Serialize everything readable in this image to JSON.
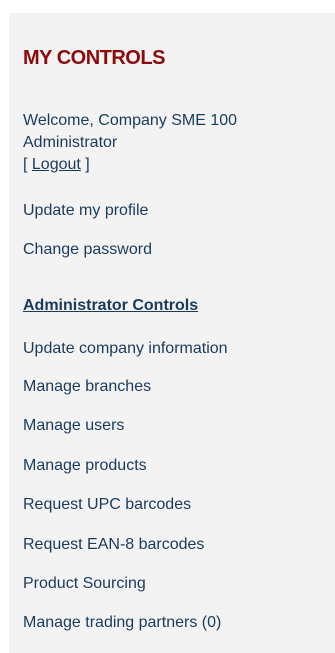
{
  "panel": {
    "title": "MY CONTROLS",
    "welcome": {
      "line1": "Welcome, Company SME 100",
      "line2": "Administrator",
      "bracket_open": "[ ",
      "logout_label": "Logout",
      "bracket_close": " ]"
    },
    "user_links": [
      {
        "label": "Update my profile"
      },
      {
        "label": "Change password"
      }
    ],
    "admin_heading": "Administrator Controls",
    "admin_links": [
      {
        "label": "Update company information"
      },
      {
        "label": "Manage branches"
      },
      {
        "label": "Manage users"
      },
      {
        "label": "Manage products"
      },
      {
        "label": "Request UPC barcodes"
      },
      {
        "label": "Request EAN-8 barcodes"
      },
      {
        "label": "Product Sourcing"
      },
      {
        "label": "Manage trading partners (0)"
      }
    ]
  },
  "colors": {
    "title": "#8b0a0a",
    "link": "#1a3a5c",
    "panel_background": "#f3f3f3"
  }
}
